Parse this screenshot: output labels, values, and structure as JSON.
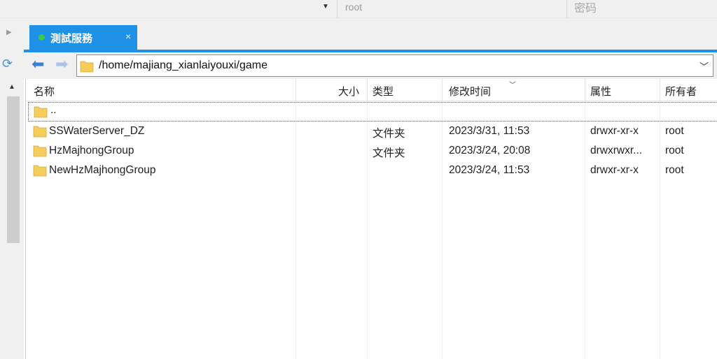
{
  "topbar": {
    "username": "root",
    "password_placeholder": "密码"
  },
  "tab": {
    "label": "測試服務",
    "close": "×",
    "status_color": "#3cc84a"
  },
  "address": {
    "path": "/home/majiang_xianlaiyouxi/game"
  },
  "columns": {
    "name": "名称",
    "size": "大小",
    "type": "类型",
    "modified": "修改时间",
    "attributes": "属性",
    "owner": "所有者"
  },
  "rows": [
    {
      "name": "..",
      "type": "",
      "modified": "",
      "attributes": "",
      "owner": ""
    },
    {
      "name": "SSWaterServer_DZ",
      "type": "文件夹",
      "modified": "2023/3/31, 11:53",
      "attributes": "drwxr-xr-x",
      "owner": "root"
    },
    {
      "name": "HzMajhongGroup",
      "type": "文件夹",
      "modified": "2023/3/24, 20:08",
      "attributes": "drwxrwxr...",
      "owner": "root"
    },
    {
      "name": "NewHzMajhongGroup",
      "type": "",
      "modified": "2023/3/24, 11:53",
      "attributes": "drwxr-xr-x",
      "owner": "root"
    }
  ],
  "colors": {
    "accent": "#1e90e6",
    "folder": "#f5cd5c"
  }
}
